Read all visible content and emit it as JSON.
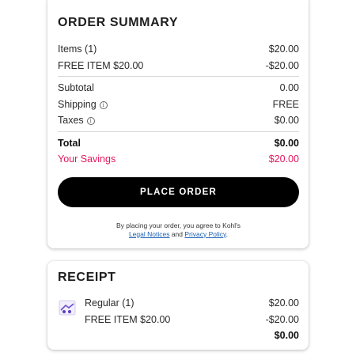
{
  "order_summary": {
    "title": "ORDER SUMMARY",
    "items_label": "Items (1)",
    "items_value": "$20.00",
    "free_item_label": "FREE ITEM $20.00",
    "free_item_value": "-$20.00",
    "subtotal_label": "Subtotal",
    "subtotal_value": "0.00",
    "shipping_label": "Shipping",
    "shipping_value": "FREE",
    "taxes_label": "Taxes",
    "taxes_value": "$0.00",
    "total_label": "Total",
    "total_value": "$0.00",
    "savings_label": "Your Savings",
    "savings_value": "$20.00",
    "place_order_label": "PLACE ORDER",
    "legal_prefix": "By placing your order, you agree to Kohl's",
    "legal_notices_link": "Legal Notices",
    "legal_and": "and",
    "privacy_policy_link": "Privacy Policy",
    "legal_suffix": "."
  },
  "receipt": {
    "title": "RECEIPT",
    "item_label": "Regular (1)",
    "item_value": "$20.00",
    "free_item_label": "FREE ITEM $20.00",
    "free_item_value": "-$20.00",
    "total_value": "$0.00"
  },
  "colors": {
    "savings": "#e3185c",
    "button": "#000000",
    "link": "#1a5fb4"
  },
  "icons": {
    "info": "info-circle-icon",
    "product": "product-thumbnail-icon"
  }
}
